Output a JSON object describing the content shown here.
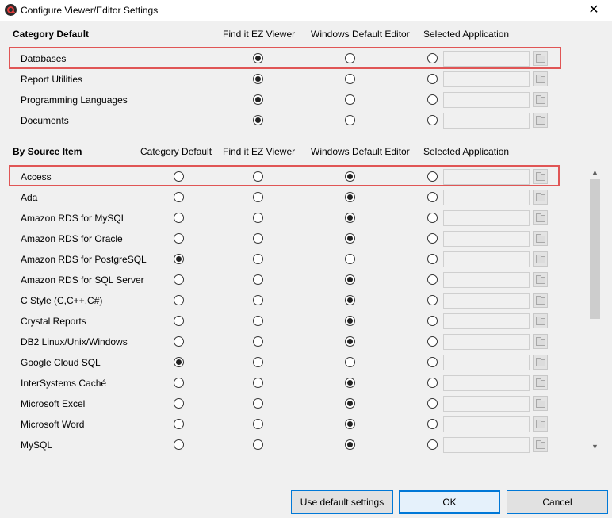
{
  "window": {
    "title": "Configure Viewer/Editor Settings"
  },
  "category_section": {
    "title": "Category Default",
    "columns": [
      "Find it EZ Viewer",
      "Windows Default Editor",
      "Selected Application"
    ],
    "rows": [
      {
        "label": "Databases",
        "selected": 0,
        "app_path": ""
      },
      {
        "label": "Report Utilities",
        "selected": 0,
        "app_path": ""
      },
      {
        "label": "Programming Languages",
        "selected": 0,
        "app_path": ""
      },
      {
        "label": "Documents",
        "selected": 0,
        "app_path": ""
      }
    ]
  },
  "source_section": {
    "title": "By Source Item",
    "columns": [
      "Category Default",
      "Find it EZ Viewer",
      "Windows Default Editor",
      "Selected Application"
    ],
    "rows": [
      {
        "label": "Access",
        "selected": 2,
        "app_path": ""
      },
      {
        "label": "Ada",
        "selected": 2,
        "app_path": ""
      },
      {
        "label": "Amazon RDS for MySQL",
        "selected": 2,
        "app_path": ""
      },
      {
        "label": "Amazon RDS for Oracle",
        "selected": 2,
        "app_path": ""
      },
      {
        "label": "Amazon RDS for PostgreSQL",
        "selected": 0,
        "app_path": ""
      },
      {
        "label": "Amazon RDS for SQL Server",
        "selected": 2,
        "app_path": ""
      },
      {
        "label": "C Style (C,C++,C#)",
        "selected": 2,
        "app_path": ""
      },
      {
        "label": "Crystal Reports",
        "selected": 2,
        "app_path": ""
      },
      {
        "label": "DB2 Linux/Unix/Windows",
        "selected": 2,
        "app_path": ""
      },
      {
        "label": "Google Cloud SQL",
        "selected": 0,
        "app_path": ""
      },
      {
        "label": "InterSystems Caché",
        "selected": 2,
        "app_path": ""
      },
      {
        "label": "Microsoft Excel",
        "selected": 2,
        "app_path": ""
      },
      {
        "label": "Microsoft Word",
        "selected": 2,
        "app_path": ""
      },
      {
        "label": "MySQL",
        "selected": 2,
        "app_path": ""
      }
    ]
  },
  "footer": {
    "default_button": "Use default settings",
    "ok_button": "OK",
    "cancel_button": "Cancel"
  },
  "colors": {
    "highlight": "#e05555",
    "button_border": "#0078d7"
  },
  "icons": {
    "app": "find-it-ez-logo-icon",
    "close": "close-icon",
    "browse": "folder-icon",
    "scroll_up": "chevron-up-icon",
    "scroll_down": "chevron-down-icon"
  }
}
